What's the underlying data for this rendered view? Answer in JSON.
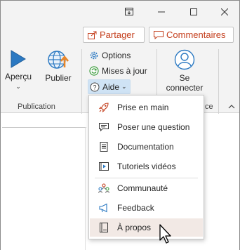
{
  "ribbon": {
    "share_label": "Partager",
    "comments_label": "Commentaires",
    "apercu_label": "Aperçu",
    "publier_label": "Publier",
    "publication_group_label": "Publication",
    "options_label": "Options",
    "mises_a_jour_label": "Mises à jour",
    "aide_label": "Aide",
    "connect_label_line1": "Se",
    "connect_label_line2": "connecter",
    "connect_group_label_fragment": "ce"
  },
  "help_menu": {
    "items": [
      {
        "label": "Prise en main",
        "icon": "rocket-icon"
      },
      {
        "label": "Poser une question",
        "icon": "chat-question-icon"
      },
      {
        "label": "Documentation",
        "icon": "book-icon"
      },
      {
        "label": "Tutoriels vidéos",
        "icon": "video-icon"
      },
      {
        "label": "Communauté",
        "icon": "community-icon"
      },
      {
        "label": "Feedback",
        "icon": "megaphone-icon"
      },
      {
        "label": "À propos",
        "icon": "about-icon"
      }
    ],
    "highlighted_item": "À propos"
  },
  "colors": {
    "accent": "#c43e1c",
    "blue": "#2b79c2",
    "highlight": "#f2e9e5",
    "aide_highlight": "#cfe3f5"
  }
}
